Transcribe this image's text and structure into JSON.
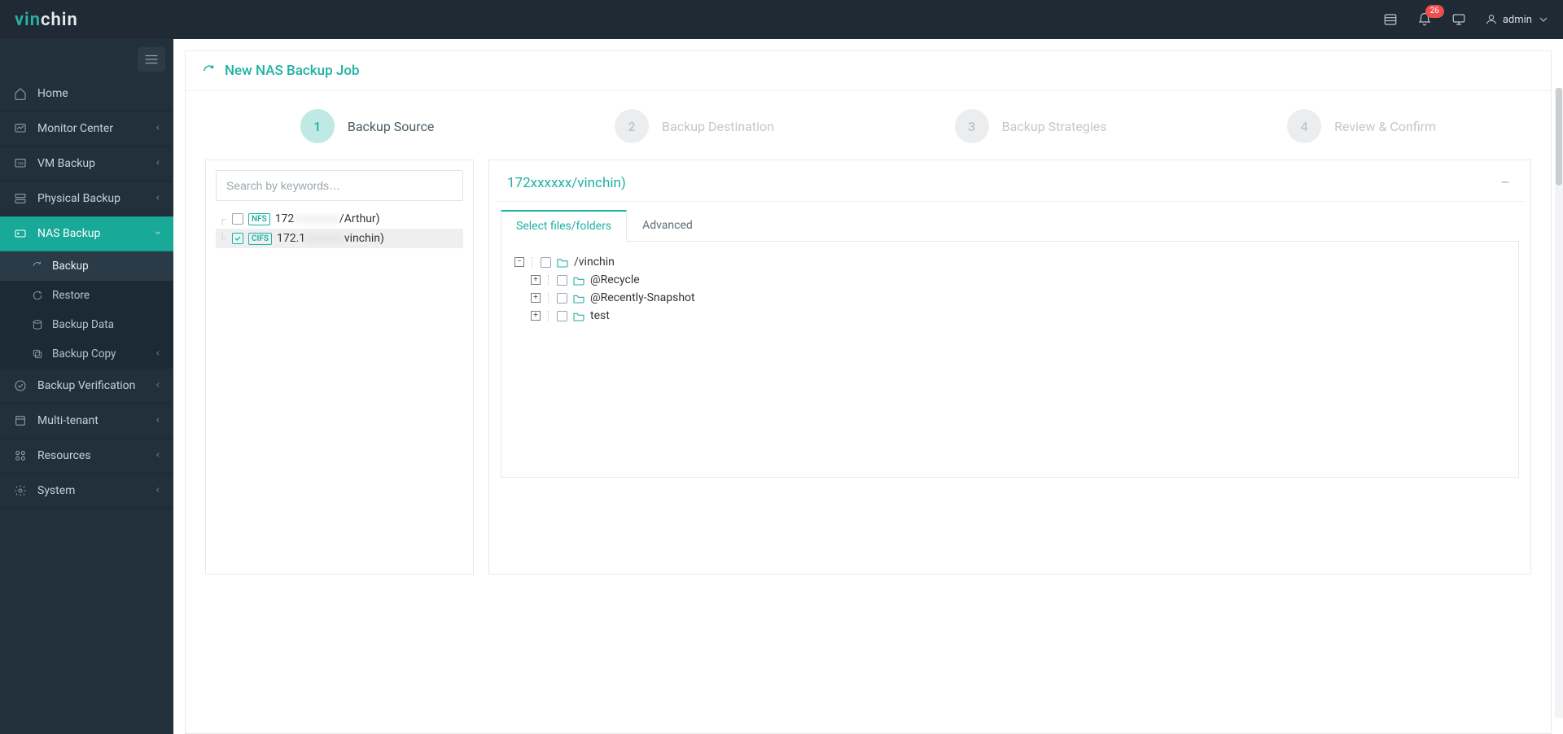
{
  "header": {
    "brand_vin": "vin",
    "brand_chin": "chin",
    "notifications_count": "26",
    "username": "admin"
  },
  "sidebar": {
    "items": [
      {
        "label": "Home"
      },
      {
        "label": "Monitor Center"
      },
      {
        "label": "VM Backup"
      },
      {
        "label": "Physical Backup"
      },
      {
        "label": "NAS Backup"
      },
      {
        "label": "Backup Verification"
      },
      {
        "label": "Multi-tenant"
      },
      {
        "label": "Resources"
      },
      {
        "label": "System"
      }
    ],
    "nas_sub": [
      {
        "label": "Backup"
      },
      {
        "label": "Restore"
      },
      {
        "label": "Backup Data"
      },
      {
        "label": "Backup Copy"
      }
    ]
  },
  "page": {
    "title": "New NAS Backup Job",
    "steps": [
      {
        "num": "1",
        "label": "Backup Source"
      },
      {
        "num": "2",
        "label": "Backup Destination"
      },
      {
        "num": "3",
        "label": "Backup Strategies"
      },
      {
        "num": "4",
        "label": "Review & Confirm"
      }
    ]
  },
  "source_panel": {
    "search_placeholder": "Search by keywords…",
    "shares": [
      {
        "tag": "NFS",
        "prefix": "172",
        "suffix": "/Arthur)",
        "checked": false
      },
      {
        "tag": "CIFS",
        "prefix": "172.1",
        "suffix": "vinchin)",
        "checked": true
      }
    ]
  },
  "right_panel": {
    "title_prefix": "172",
    "title_suffix": "/vinchin)",
    "collapse_char": "—",
    "tabs": [
      {
        "label": "Select files/folders"
      },
      {
        "label": "Advanced"
      }
    ],
    "root": {
      "name": "/vinchin",
      "children": [
        {
          "name": "@Recycle"
        },
        {
          "name": "@Recently-Snapshot"
        },
        {
          "name": "test"
        }
      ]
    }
  }
}
